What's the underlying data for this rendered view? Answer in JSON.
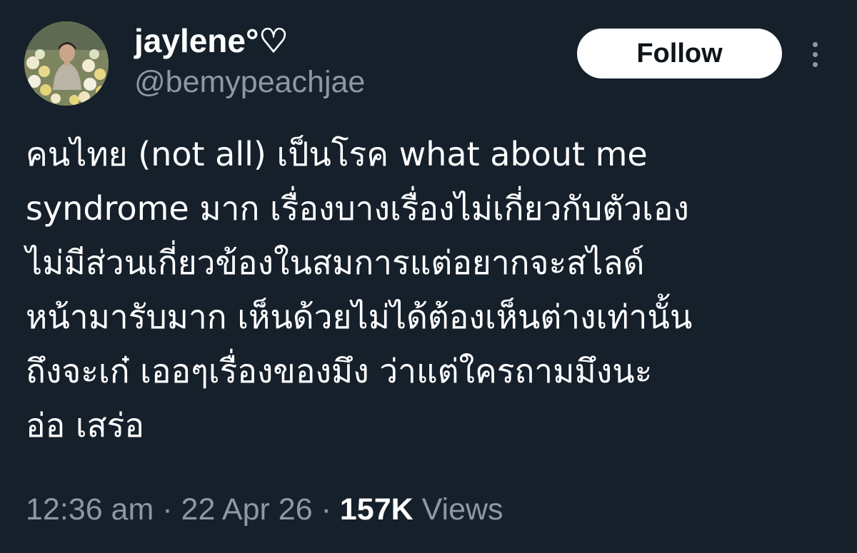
{
  "user": {
    "display_name": "jaylene°♡",
    "handle": "@bemypeachjae"
  },
  "actions": {
    "follow_label": "Follow",
    "more_icon": "more-vertical-icon"
  },
  "tweet": {
    "lines": [
      "คนไทย (not all) เป็นโรค what about me",
      "syndrome มาก เรื่องบางเรื่องไม่เกี่ยวกับตัวเอง",
      "ไม่มีส่วนเกี่ยวข้องในสมการแต่อยากจะสไลด์",
      "หน้ามารับมาก เห็นด้วยไม่ได้ต้องเห็นต่างเท่านั้น",
      "ถึงจะเก๋ เออๆเรื่องของมึง ว่าแต่ใครถามมึงนะ",
      "อ่อ เสร่อ"
    ]
  },
  "meta": {
    "time": "12:36 am",
    "separator": "·",
    "date": "22 Apr 26",
    "views_count": "157K",
    "views_label": "Views"
  },
  "colors": {
    "background": "#15202b",
    "text_primary": "#ffffff",
    "text_secondary": "#8b98a5",
    "follow_bg": "#ffffff",
    "follow_text": "#0f1419"
  }
}
